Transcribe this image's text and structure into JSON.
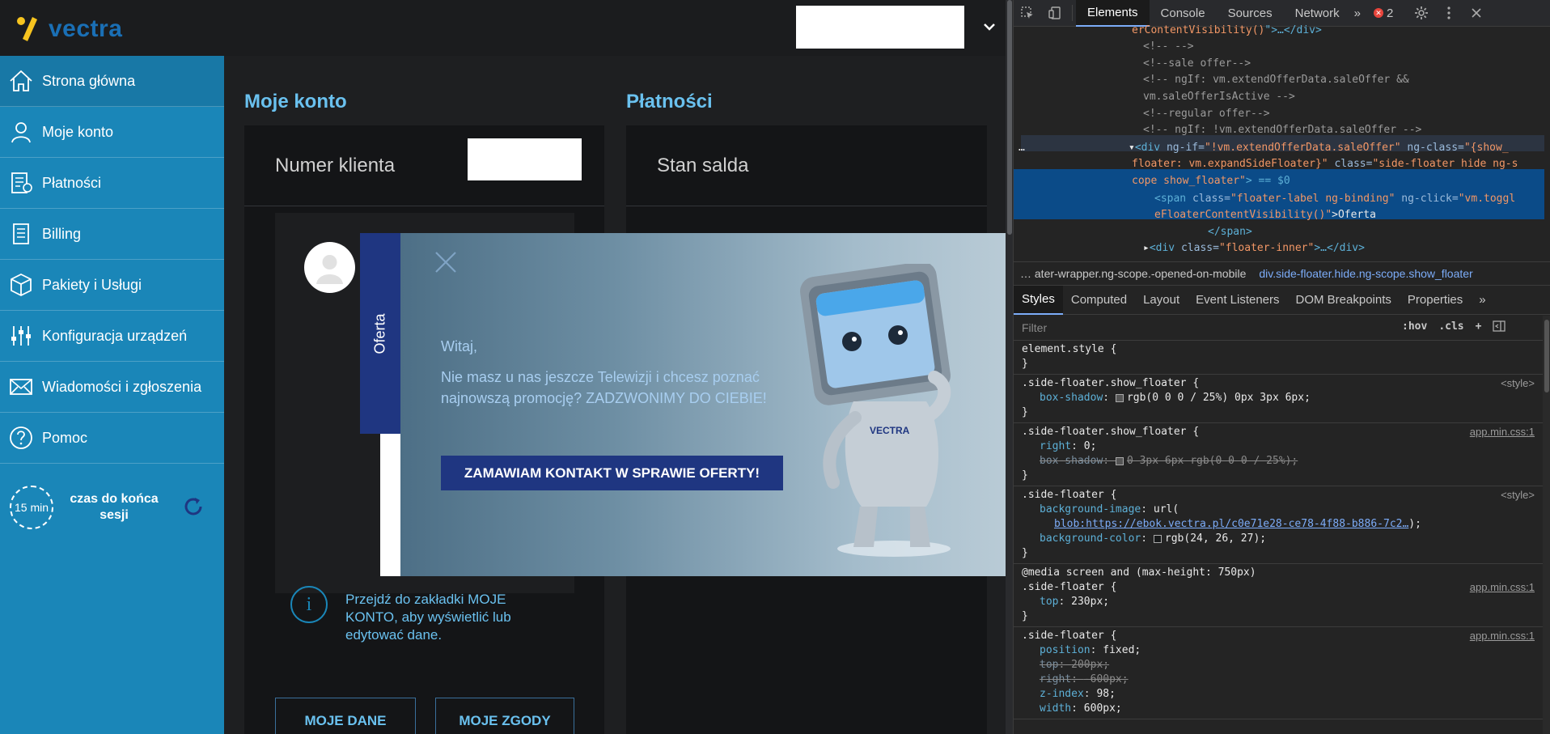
{
  "app": {
    "logo_text": "vectra",
    "nav": [
      {
        "label": "Strona główna",
        "icon": "home-icon"
      },
      {
        "label": "Moje konto",
        "icon": "user-icon"
      },
      {
        "label": "Płatności",
        "icon": "payments-icon"
      },
      {
        "label": "Billing",
        "icon": "billing-icon"
      },
      {
        "label": "Pakiety i Usługi",
        "icon": "package-icon"
      },
      {
        "label": "Konfiguracja urządzeń",
        "icon": "sliders-icon"
      },
      {
        "label": "Wiadomości i zgłoszenia",
        "icon": "envelope-icon"
      },
      {
        "label": "Pomoc",
        "icon": "help-icon"
      }
    ],
    "session": {
      "time": "15 min",
      "label": "czas do końca sesji"
    },
    "account": {
      "title": "Moje konto",
      "client_label": "Numer klienta",
      "info_text": "Przejdź do zakładki MOJE KONTO, aby wyświetlić lub edytować dane.",
      "info_icon": "i",
      "btn_data": "MOJE DANE",
      "btn_consents": "MOJE ZGODY"
    },
    "payments": {
      "title": "Płatności",
      "balance_label": "Stan salda"
    },
    "floater": {
      "tab_label": "Oferta",
      "greeting": "Witaj,",
      "message": "Nie masz u nas jeszcze Telewizji i chcesz poznać najnowszą promocję? ZADZWONIMY DO CIEBIE!",
      "cta": "ZAMAWIAM KONTAKT W SPRAWIE OFERTY!",
      "mascot_text": "VECTRA"
    }
  },
  "devtools": {
    "tabs": [
      "Elements",
      "Console",
      "Sources",
      "Network"
    ],
    "more": "»",
    "error_count": "2",
    "dom": {
      "l1_val": "erContentVisibility()",
      "l1_rest": "\">…</div>",
      "l2": "<!-- -->",
      "l3": "<!--sale offer-->",
      "l4": "<!-- ngIf: vm.extendOfferData.saleOffer &&",
      "l5": "vm.saleOfferIsActive -->",
      "l6": "<!--regular offer-->",
      "l7": "<!-- ngIf: !vm.extendOfferData.saleOffer -->",
      "l8_tag": "<div",
      "l8_a1": " ng-if=",
      "l8_v1": "\"!vm.extendOfferData.saleOffer\"",
      "l8_a2": " ng-class=",
      "l8_v2": "\"{show_",
      "l9": "floater: vm.expandSideFloater}\"",
      "l9_a": " class=",
      "l9_v": "\"side-floater hide ng-s",
      "l10_v": "cope show_floater\"",
      "l10_rest": "> == $0",
      "l11_tag": "<span",
      "l11_a1": " class=",
      "l11_v1": "\"floater-label ng-binding\"",
      "l11_a2": " ng-click=",
      "l11_v2": "\"vm.toggl",
      "l12_v": "eFloaterContentVisibility()\"",
      "l12_text": ">Oferta",
      "l13": "</span>",
      "l14_tag": "<div",
      "l14_a": " class=",
      "l14_v": "\"floater-inner\"",
      "l14_rest": ">…</div>",
      "dots": "…"
    },
    "breadcrumb": [
      "… ater-wrapper.ng-scope.-opened-on-mobile",
      "div.side-floater.hide.ng-scope.show_floater"
    ],
    "subtabs": [
      "Styles",
      "Computed",
      "Layout",
      "Event Listeners",
      "DOM Breakpoints",
      "Properties"
    ],
    "filter_placeholder": "Filter",
    "filter_tools": [
      ":hov",
      ".cls",
      "+"
    ],
    "rules": {
      "r1_sel": "element.style {",
      "r2_sel": ".side-floater.show_floater {",
      "r2_src": "<style>",
      "r2_d1p": "box-shadow",
      "r2_d1v": "rgb(0 0 0 / 25%) 0px 3px 6px;",
      "r3_sel": ".side-floater.show_floater {",
      "r3_src": "app.min.css:1",
      "r3_d1p": "right",
      "r3_d1v": "0;",
      "r3_d2p": "box-shadow",
      "r3_d2v": "0 3px 6px rgb(0 0 0 / 25%);",
      "r4_sel": ".side-floater {",
      "r4_src": "<style>",
      "r4_d1p": "background-image",
      "r4_d1v": "url(",
      "r4_url": "blob:https://ebok.vectra.pl/c0e71e28-ce78-4f88-b886-7c2…",
      "r4_url_end": ");",
      "r4_d2p": "background-color",
      "r4_d2v": "rgb(24, 26, 27);",
      "r5_media": "@media screen and (max-height: 750px)",
      "r5_sel": ".side-floater {",
      "r5_src": "app.min.css:1",
      "r5_d1p": "top",
      "r5_d1v": "230px;",
      "r6_sel": ".side-floater {",
      "r6_src": "app.min.css:1",
      "r6_d1p": "position",
      "r6_d1v": "fixed;",
      "r6_d2p": "top",
      "r6_d2v": "200px;",
      "r6_d3p": "right",
      "r6_d3v": "-600px;",
      "r6_d4p": "z-index",
      "r6_d4v": "98;",
      "r6_d5p": "width",
      "r6_d5v": "600px;",
      "close_brace": "}"
    }
  }
}
